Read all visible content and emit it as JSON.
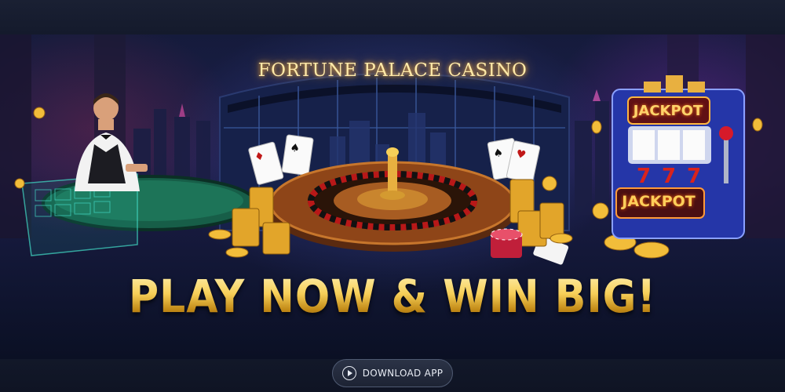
{
  "banner": {
    "casino_name": "FORTUNE PALACE CASINO",
    "headline": "PLAY NOW & WIN BIG!",
    "slot_machine": {
      "top_label": "JACKPOT",
      "reels": [
        "7",
        "7",
        "7"
      ],
      "bottom_label": "JACKPOT"
    }
  },
  "footer": {
    "download_button": {
      "label": "DOWNLOAD APP",
      "icon": "play-circle-icon"
    }
  },
  "colors": {
    "gold": "#f6cf58",
    "neon_title": "#ffe9a8",
    "background": "#0e1426",
    "button_bg": "#2b3346"
  }
}
